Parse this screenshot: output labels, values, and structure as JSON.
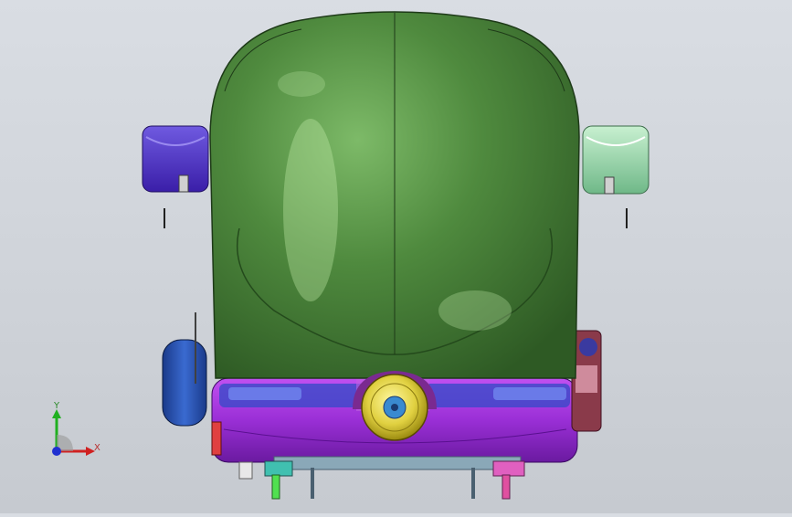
{
  "view": {
    "background_top": "#d9dde3",
    "background_bottom": "#c6cad0"
  },
  "model": {
    "seat_color": "#4e8a3c",
    "base_color": "#9a2fd6",
    "left_armrest_color": "#5030c8",
    "right_armrest_color": "#9ad8a8",
    "knob_color": "#e0d040"
  },
  "triad": {
    "x_label": "X",
    "y_label": "Y",
    "x_color": "#d02020",
    "y_color": "#20b020",
    "z_color": "#2030d0"
  }
}
